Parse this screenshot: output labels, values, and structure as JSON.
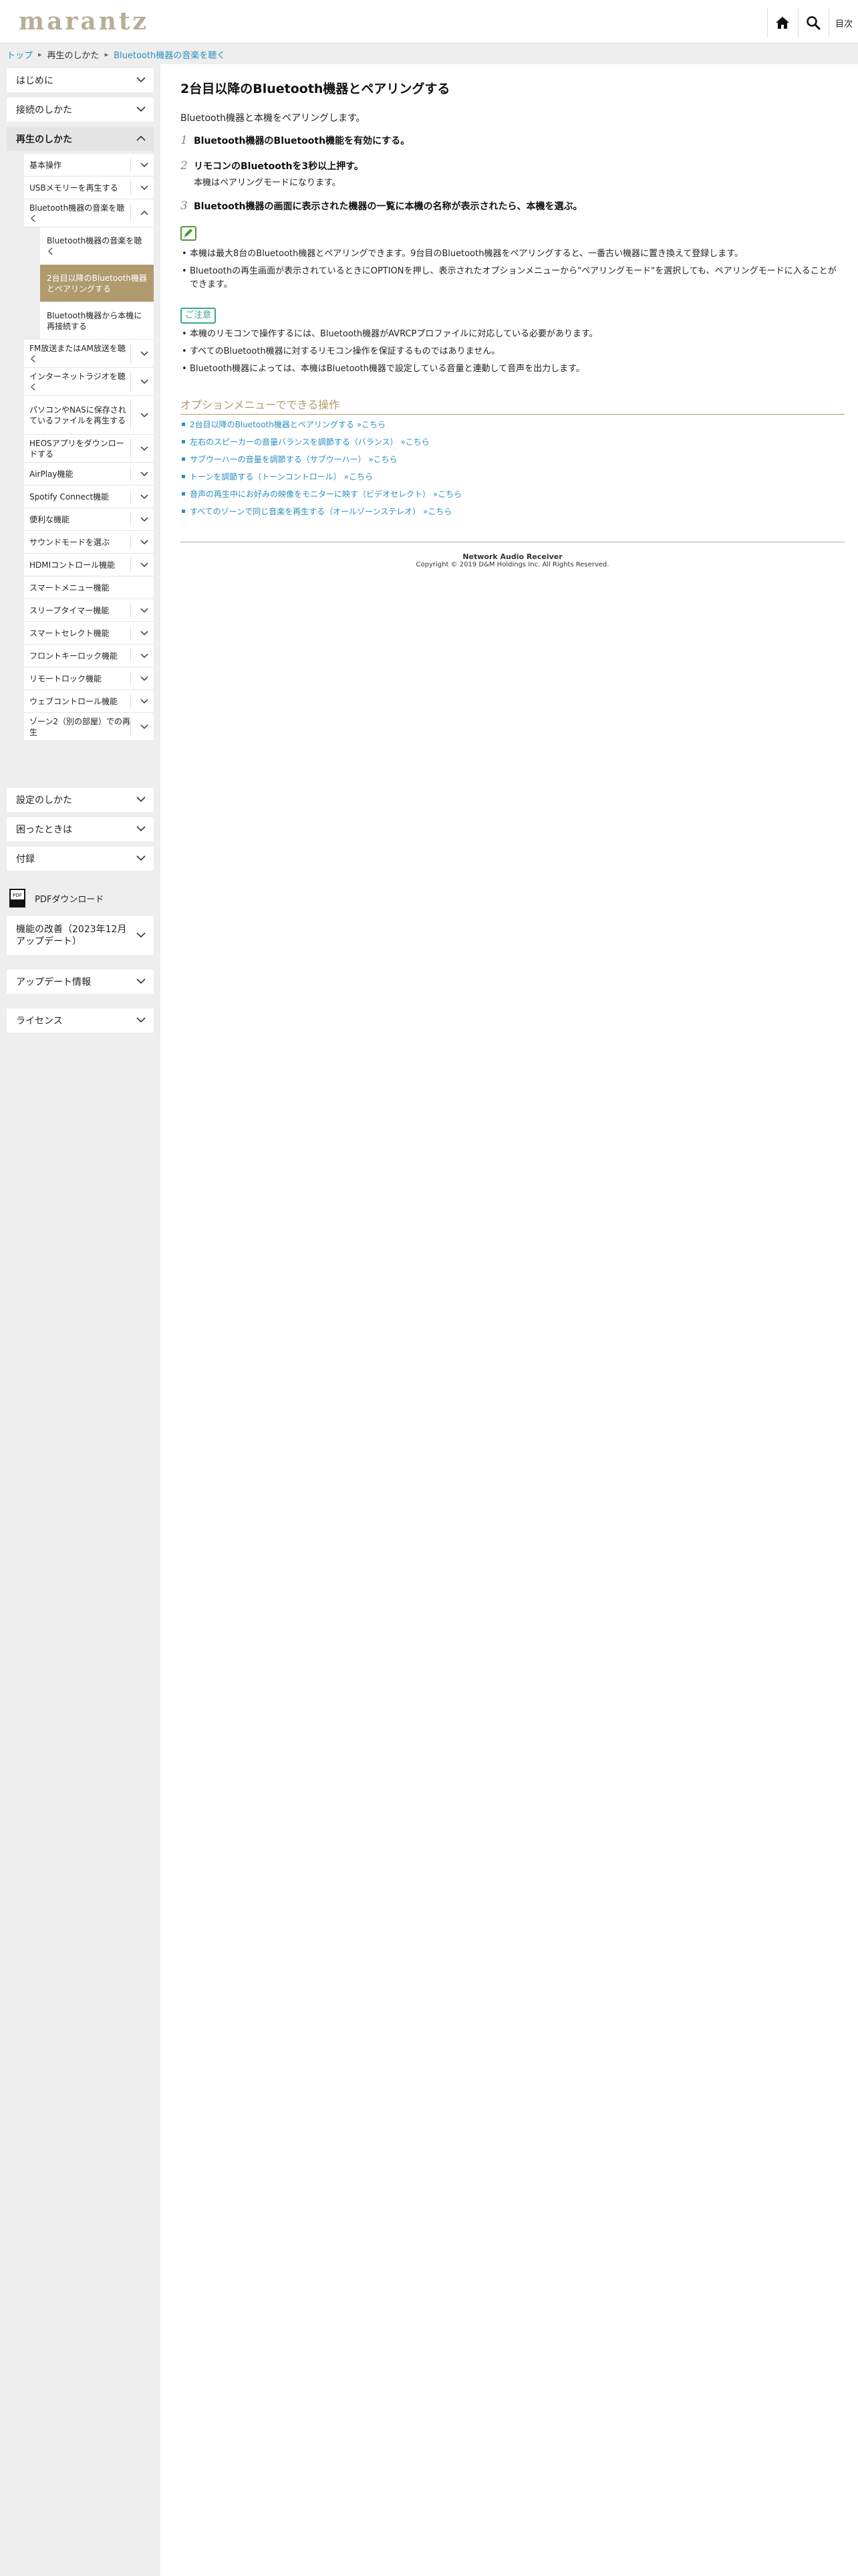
{
  "header": {
    "logo": "marantz",
    "home_icon": "home-icon",
    "search_icon": "search-icon",
    "toc_label": "目次"
  },
  "breadcrumb": {
    "top": "トップ",
    "level2": "再生のしかた",
    "level3": "Bluetooth機器の音楽を聴く"
  },
  "sidebar": {
    "items": [
      {
        "label": "はじめに"
      },
      {
        "label": "接続のしかた"
      },
      {
        "label": "再生のしかた"
      },
      {
        "label": "設定のしかた"
      },
      {
        "label": "困ったときは"
      },
      {
        "label": "付録"
      }
    ],
    "playback_subitems": [
      {
        "label": "基本操作"
      },
      {
        "label": "USBメモリーを再生する"
      },
      {
        "label": "Bluetooth機器の音楽を聴く"
      },
      {
        "label": "FM放送またはAM放送を聴く"
      },
      {
        "label": "インターネットラジオを聴く"
      },
      {
        "label": "パソコンやNASに保存されているファイルを再生する"
      },
      {
        "label": "HEOSアプリをダウンロードする"
      },
      {
        "label": "AirPlay機能"
      },
      {
        "label": "Spotify Connect機能"
      },
      {
        "label": "便利な機能"
      },
      {
        "label": "サウンドモードを選ぶ"
      },
      {
        "label": "HDMIコントロール機能"
      },
      {
        "label": "スマートメニュー機能"
      },
      {
        "label": "スリープタイマー機能"
      },
      {
        "label": "スマートセレクト機能"
      },
      {
        "label": "フロントキーロック機能"
      },
      {
        "label": "リモートロック機能"
      },
      {
        "label": "ウェブコントロール機能"
      },
      {
        "label": "ゾーン2（別の部屋）での再生"
      }
    ],
    "bluetooth_subitems": [
      {
        "label": "Bluetooth機器の音楽を聴く"
      },
      {
        "label": "2台目以降のBluetooth機器とペアリングする"
      },
      {
        "label": "Bluetooth機器から本機に再接続する"
      }
    ],
    "pdf_download": "PDFダウンロード",
    "extra_items": [
      {
        "label": "機能の改善（2023年12月アップデート）"
      },
      {
        "label": "アップデート情報"
      },
      {
        "label": "ライセンス"
      }
    ]
  },
  "main": {
    "title": "2台目以降のBluetooth機器とペアリングする",
    "intro": "Bluetooth機器と本機をペアリングします。",
    "steps": [
      {
        "num": "1",
        "text": "Bluetooth機器のBluetooth機能を有効にする。",
        "sub": ""
      },
      {
        "num": "2",
        "text": "リモコンのBluetoothを3秒以上押す。",
        "sub": "本機はペアリングモードになります。"
      },
      {
        "num": "3",
        "text": "Bluetooth機器の画面に表示された機器の一覧に本機の名称が表示されたら、本機を選ぶ。",
        "sub": ""
      }
    ],
    "notes": [
      "本機は最大8台のBluetooth機器とペアリングできます。9台目のBluetooth機器をペアリングすると、一番古い機器に置き換えて登録します。",
      "Bluetoothの再生画面が表示されているときにOPTIONを押し、表示されたオプションメニューから\"ペアリングモード\"を選択しても、ペアリングモードに入ることができます。"
    ],
    "caution_label": "ご注意",
    "cautions": [
      "本機のリモコンで操作するには、Bluetooth機器がAVRCPプロファイルに対応している必要があります。",
      "すべてのBluetooth機器に対するリモコン操作を保証するものではありません。",
      "Bluetooth機器によっては、本機はBluetooth機器で設定している音量と連動して音声を出力します。"
    ],
    "options_title": "オプションメニューでできる操作",
    "options": [
      "2台目以降のBluetooth機器とペアリングする  »こちら",
      "左右のスピーカーの音量バランスを調節する（バランス）  »こちら",
      "サブウーハーの音量を調節する（サブウーハー）  »こちら",
      "トーンを調節する（トーンコントロール）  »こちら",
      "音声の再生中にお好みの映像をモニターに映す（ビデオセレクト）  »こちら",
      "すべてのゾーンで同じ音楽を再生する（オールゾーンステレオ）  »こちら"
    ]
  },
  "footer": {
    "product": "Network Audio Receiver",
    "copyright": "Copyright © 2019 D&M Holdings Inc. All Rights Reserved."
  },
  "colors": {
    "accent_gold": "#b09a6e",
    "link_blue": "#2a8fc1",
    "caution_green": "#3aa88a",
    "note_green": "#4a9a3a"
  }
}
